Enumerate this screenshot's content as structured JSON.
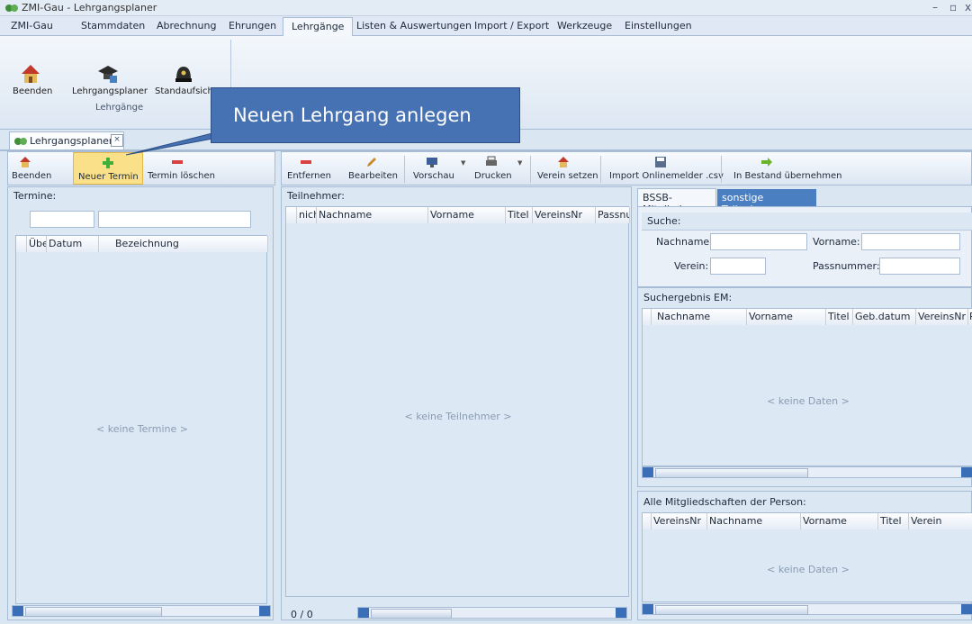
{
  "window": {
    "title": "ZMI-Gau - Lehrgangsplaner"
  },
  "ribbon_tabs": [
    "ZMI-Gau",
    "Stammdaten",
    "Abrechnung",
    "Ehrungen",
    "Lehrgänge",
    "Listen & Auswertungen",
    "Import / Export",
    "Werkzeuge",
    "Einstellungen"
  ],
  "ribbon": {
    "buttons": [
      "Beenden",
      "Lehrgangsplaner",
      "Standaufsicht"
    ],
    "group_label": "Lehrgänge"
  },
  "callout": {
    "text": "Neuen Lehrgang anlegen"
  },
  "doc_tab": {
    "label": "Lehrgangsplaner",
    "close": "×"
  },
  "left_toolbar": [
    "Beenden",
    "Neuer Termin",
    "Termin löschen"
  ],
  "mid_toolbar": [
    "Entfernen",
    "Bearbeiten",
    "Vorschau",
    "Drucken",
    "Verein setzen",
    "Import Onlinemelder .csv",
    "In Bestand übernehmen"
  ],
  "termine": {
    "header": "Termine:",
    "columns": [
      "Übe",
      "Datum",
      "Bezeichnung"
    ],
    "empty": "< keine Termine >"
  },
  "teilnehmer": {
    "header": "Teilnehmer:",
    "columns": [
      "nich",
      "Nachname",
      "Vorname",
      "Titel",
      "VereinsNr",
      "Passnur"
    ],
    "empty": "< keine Teilnehmer >",
    "count": "0 / 0"
  },
  "right_tabs": [
    "BSSB-Mitglieder",
    "sonstige Teilnehmer"
  ],
  "suche": {
    "header": "Suche:",
    "nachname_label": "Nachname:",
    "vorname_label": "Vorname:",
    "verein_label": "Verein:",
    "passnummer_label": "Passnummer:"
  },
  "suchergebnis": {
    "header": "Suchergebnis EM:",
    "columns": [
      "Nachname",
      "Vorname",
      "Titel",
      "Geb.datum",
      "VereinsNr",
      "Pa"
    ],
    "empty": "< keine Daten >"
  },
  "mitgliedschaften": {
    "header": "Alle Mitgliedschaften der Person:",
    "columns": [
      "VereinsNr",
      "Nachname",
      "Vorname",
      "Titel",
      "Verein"
    ],
    "empty": "< keine Daten >"
  },
  "colors": {
    "accent": "#4672b4",
    "highlight": "#fbe08a"
  }
}
